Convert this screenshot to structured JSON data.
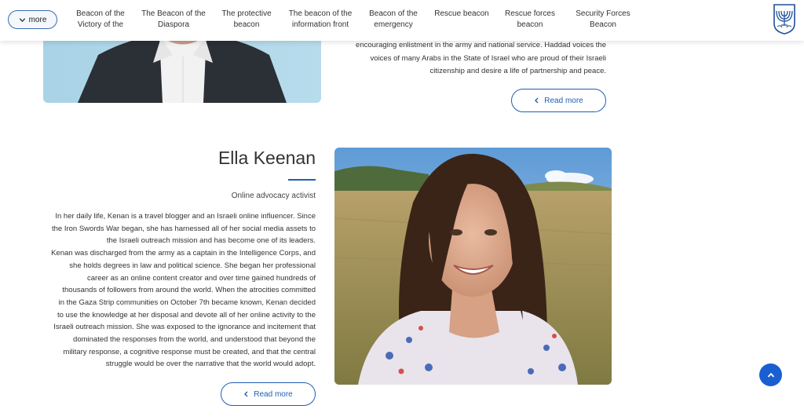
{
  "nav": {
    "more_label": "more",
    "items": [
      "Beacon of the Victory of the",
      "The Beacon of the Diaspora",
      "The protective beacon",
      "The beacon of the information front",
      "Beacon of the emergency",
      "Rescue beacon",
      "Rescue forces beacon",
      "Security Forces Beacon"
    ],
    "logo_icon": "menorah-emblem-icon"
  },
  "previous_card": {
    "text_lines": [
      "encouraging enlistment in the army and national service. Haddad voices the",
      "voices of many Arabs in the State of Israel who are proud of their Israeli",
      "citizenship and desire a life of partnership and peace."
    ],
    "read_more_label": "Read more"
  },
  "profile": {
    "name": "Ella Keenan",
    "role": "Online advocacy activist",
    "bio_lines": [
      "In her daily life, Kenan is a travel blogger and an Israeli online influencer. Since",
      "the Iron Swords War began, she has harnessed all of her social media assets to",
      "the Israeli outreach mission and has become one of its leaders.",
      "Kenan was discharged from the army as a captain in the Intelligence Corps, and",
      "she holds degrees in law and political science. She began her professional",
      "career as an online content creator and over time gained hundreds of",
      "thousands of followers from around the world. When the atrocities committed",
      "in the Gaza Strip communities on October 7th became known, Kenan decided",
      "to use the knowledge at her disposal and devote all of her online activity to the",
      "Israeli outreach mission. She was exposed to the ignorance and incitement that",
      "dominated the responses from the world, and understood that beyond the",
      "military response, a cognitive response must be created, and that the central",
      "struggle would be over the narrative that the world would adopt."
    ],
    "read_more_label": "Read more"
  },
  "colors": {
    "accent": "#1f5fb4",
    "scroll_button": "#1a5fd1"
  }
}
